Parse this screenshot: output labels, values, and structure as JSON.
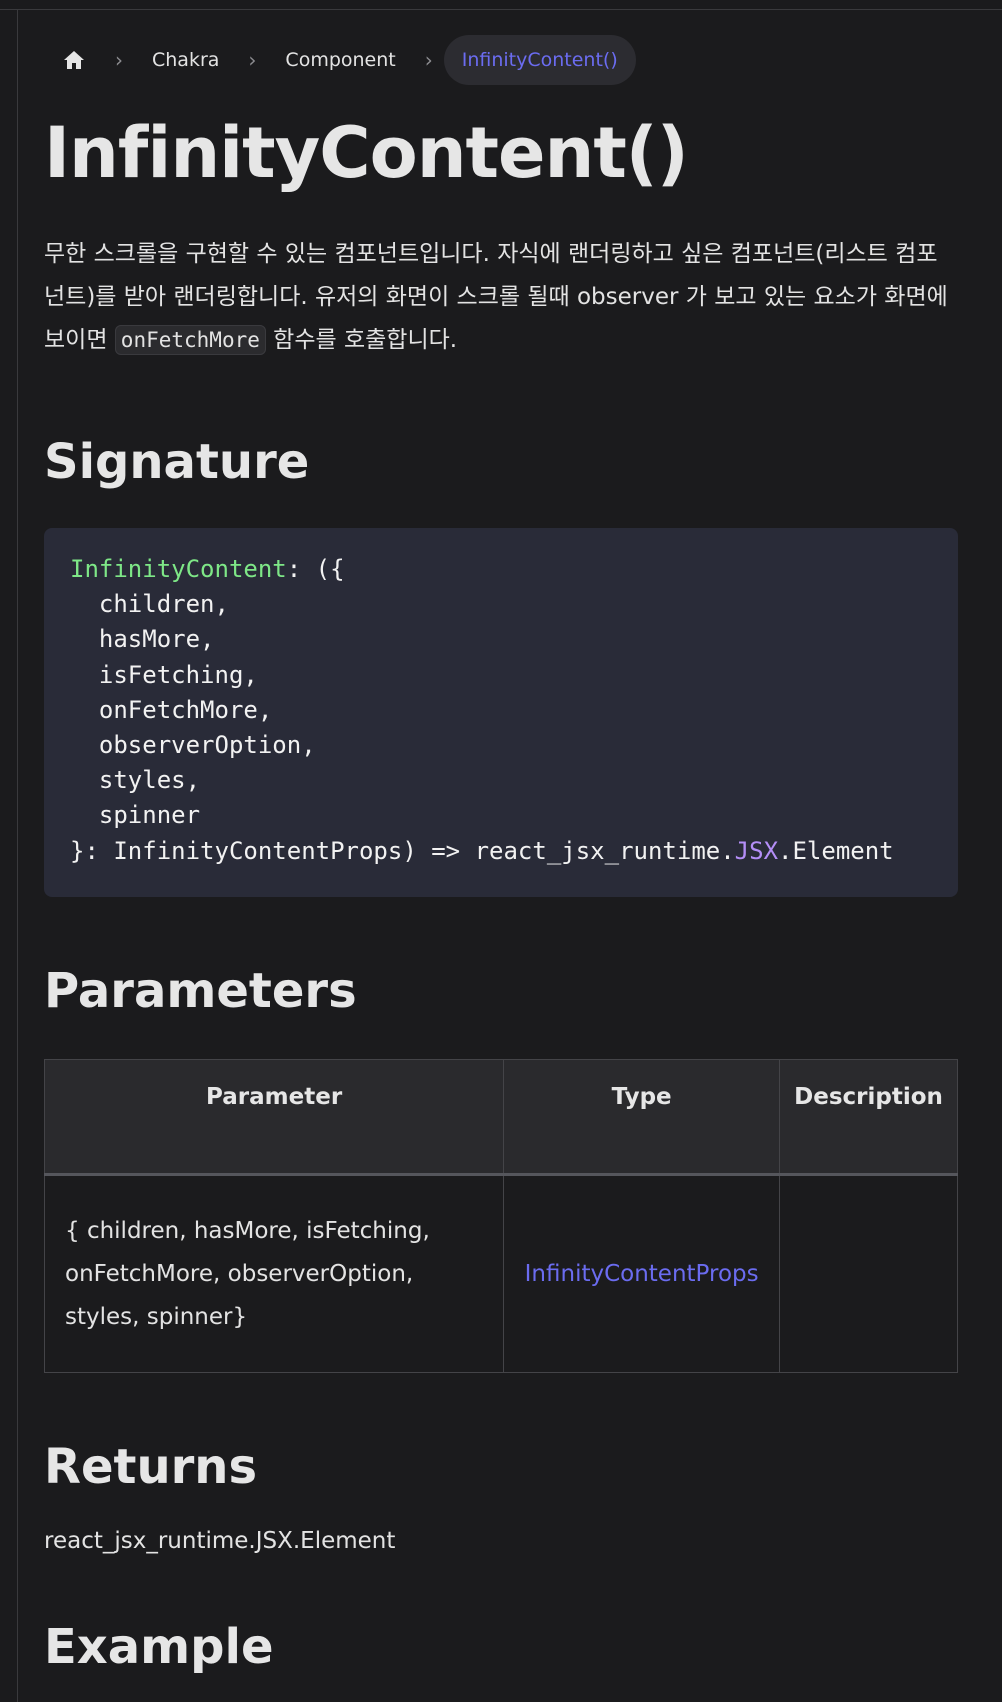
{
  "breadcrumb": {
    "home_icon": "home-icon",
    "items": [
      "Chakra",
      "Component",
      "InfinityContent()"
    ]
  },
  "page": {
    "title": "InfinityContent()",
    "intro_before": "무한 스크롤을 구현할 수 있는 컴포넌트입니다. 자식에 랜더링하고 싶은 컴포넌트(리스트 컴포넌트)를 받아 랜더링합니다. 유저의 화면이 스크롤 될때 observer 가 보고 있는 요소가 화면에 보이면 ",
    "intro_code": "onFetchMore",
    "intro_after": " 함수를 호출합니다."
  },
  "signature": {
    "heading": "Signature",
    "fn_name": "InfinityContent",
    "open": ": ({",
    "params": [
      "children,",
      "hasMore,",
      "isFetching,",
      "onFetchMore,",
      "observerOption,",
      "styles,",
      "spinner"
    ],
    "close_prefix": "}: InfinityContentProps) => react_jsx_runtime.",
    "close_kw": "JSX",
    "close_suffix": ".Element"
  },
  "parameters": {
    "heading": "Parameters",
    "headers": [
      "Parameter",
      "Type",
      "Description"
    ],
    "rows": [
      {
        "parameter": "{ children, hasMore, isFetching, onFetchMore, observerOption, styles, spinner}",
        "type": "InfinityContentProps",
        "description": ""
      }
    ]
  },
  "returns": {
    "heading": "Returns",
    "value": "react_jsx_runtime.JSX.Element"
  },
  "example": {
    "heading": "Example"
  },
  "colors": {
    "background": "#1b1b1d",
    "link": "#6b6cf0",
    "code_fn": "#7ee787",
    "code_kw": "#b48ef7"
  }
}
